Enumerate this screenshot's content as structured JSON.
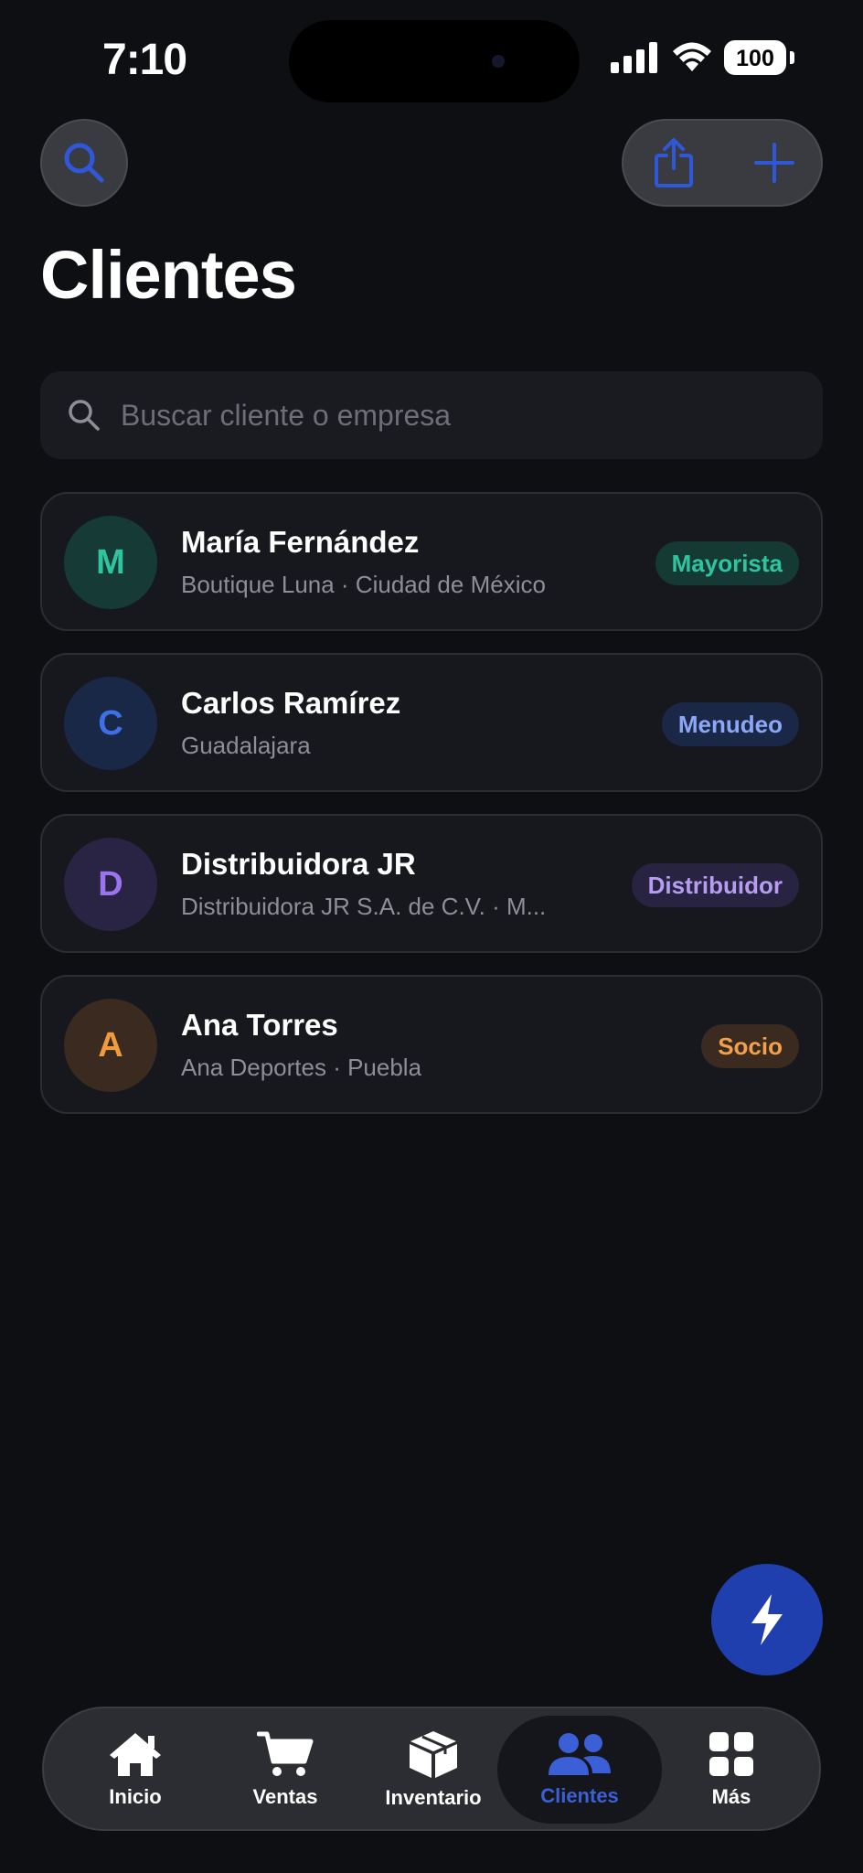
{
  "status_bar": {
    "time": "7:10",
    "battery": "100"
  },
  "header": {
    "title": "Clientes",
    "search_button_icon": "magnifier-icon",
    "share_button_icon": "share-icon",
    "add_button_icon": "plus-icon"
  },
  "search": {
    "placeholder": "Buscar cliente o empresa",
    "value": ""
  },
  "clients": [
    {
      "initial": "M",
      "name": "María Fernández",
      "subtitle": "Boutique Luna · Ciudad de México",
      "badge": "Mayorista",
      "avatar_bg": "#163a35",
      "avatar_fg": "#2ec4a0",
      "badge_bg": "#153a33",
      "badge_fg": "#2ec4a0"
    },
    {
      "initial": "C",
      "name": "Carlos Ramírez",
      "subtitle": "Guadalajara",
      "badge": "Menudeo",
      "avatar_bg": "#1a2848",
      "avatar_fg": "#3e6fe6",
      "badge_bg": "#1b2747",
      "badge_fg": "#8aa8f5"
    },
    {
      "initial": "D",
      "name": "Distribuidora JR",
      "subtitle": "Distribuidora JR S.A. de C.V. · M...",
      "badge": "Distribuidor",
      "avatar_bg": "#2a2444",
      "avatar_fg": "#9a74ee",
      "badge_bg": "#272340",
      "badge_fg": "#b79cf2"
    },
    {
      "initial": "A",
      "name": "Ana Torres",
      "subtitle": "Ana Deportes · Puebla",
      "badge": "Socio",
      "avatar_bg": "#3a2a1f",
      "avatar_fg": "#f29a3e",
      "badge_bg": "#3a2a1f",
      "badge_fg": "#f2a04a"
    }
  ],
  "fab": {
    "icon": "bolt-icon"
  },
  "tabs": [
    {
      "label": "Inicio",
      "icon": "house-icon",
      "active": false
    },
    {
      "label": "Ventas",
      "icon": "cart-icon",
      "active": false
    },
    {
      "label": "Inventario",
      "icon": "box-icon",
      "active": false
    },
    {
      "label": "Clientes",
      "icon": "people-icon",
      "active": true
    },
    {
      "label": "Más",
      "icon": "grid-icon",
      "active": false
    }
  ],
  "colors": {
    "accent": "#3a5fd6",
    "background": "#0e0f13",
    "fab": "#1f3fae"
  }
}
